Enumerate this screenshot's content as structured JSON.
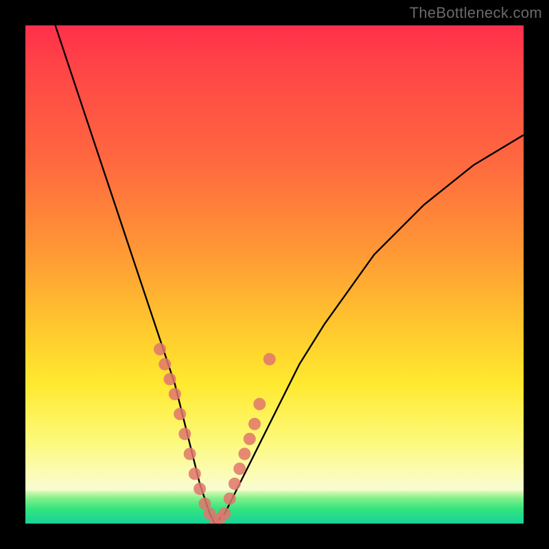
{
  "watermark": "TheBottleneck.com",
  "colors": {
    "frame": "#000000",
    "curve": "#000000",
    "marker": "#e1766c",
    "gradient_top": "#ff2f4a",
    "gradient_mid": "#ffe92f",
    "gradient_bottom": "#18d29a"
  },
  "chart_data": {
    "type": "line",
    "title": "",
    "xlabel": "",
    "ylabel": "",
    "xlim": [
      0,
      100
    ],
    "ylim": [
      0,
      100
    ],
    "grid": false,
    "note": "V-shaped bottleneck curve; y-axis reads as percentage bottleneck (0 at bottom = no bottleneck, 100 at top). Minimum (optimal match) occurs near x≈38. Values estimated from curve position against gradient bands.",
    "series": [
      {
        "name": "bottleneck-curve",
        "x": [
          6,
          10,
          14,
          18,
          22,
          26,
          30,
          33,
          35,
          37,
          38,
          40,
          42,
          45,
          50,
          55,
          60,
          70,
          80,
          90,
          100
        ],
        "y": [
          100,
          88,
          76,
          64,
          52,
          40,
          28,
          16,
          8,
          2,
          0,
          2,
          6,
          12,
          22,
          32,
          40,
          54,
          64,
          72,
          78
        ]
      }
    ],
    "markers": {
      "name": "highlighted-points",
      "note": "Clusters of points drawn on the curve near the trough on both branches.",
      "x": [
        27,
        28,
        29,
        30,
        31,
        32,
        33,
        34,
        35,
        36,
        37,
        38,
        39,
        40,
        41,
        42,
        43,
        44,
        45,
        46,
        47,
        49
      ],
      "y": [
        35,
        32,
        29,
        26,
        22,
        18,
        14,
        10,
        7,
        4,
        2,
        0,
        1,
        2,
        5,
        8,
        11,
        14,
        17,
        20,
        24,
        33
      ]
    }
  }
}
